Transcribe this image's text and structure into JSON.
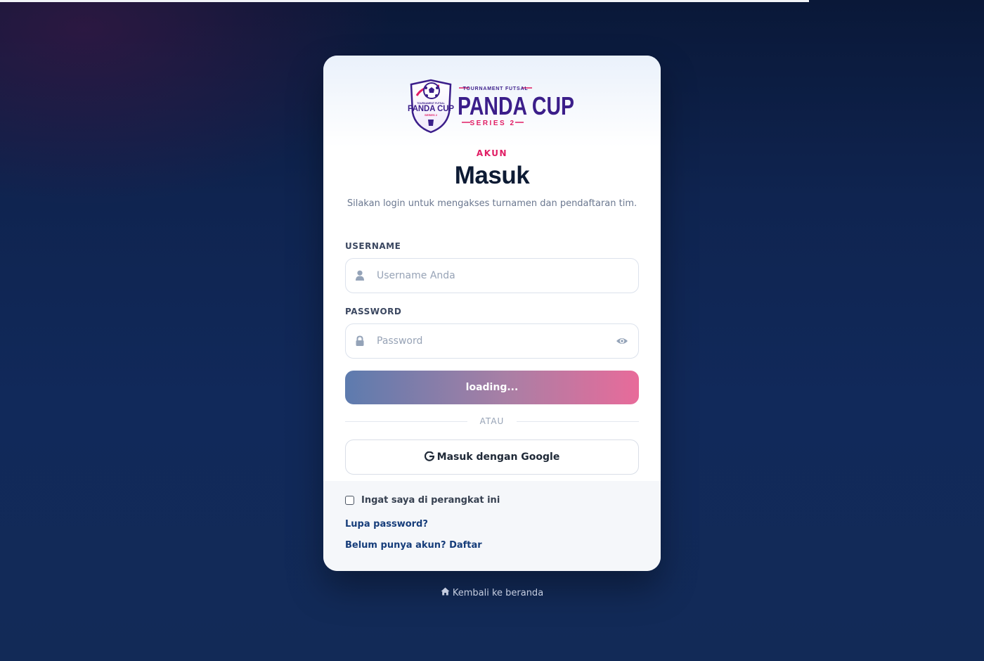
{
  "colors": {
    "accent_pink": "#e11d64",
    "link_blue": "#163d7a",
    "logo_purple": "#3b1e8a",
    "background_navy": "#0f2450"
  },
  "logo": {
    "badge_title": "PANDA CUP",
    "badge_subtitle": "TOURNAMENT FUTSAL",
    "badge_series": "SERIES 2",
    "kicker": "TOURNAMENT FUTSAL",
    "wordmark": "PANDA CUP",
    "series": "SERIES 2"
  },
  "card": {
    "eyebrow": "AKUN",
    "title": "Masuk",
    "subtitle": "Silakan login untuk mengakses turnamen dan pendaftaran tim."
  },
  "form": {
    "username_label": "USERNAME",
    "username_placeholder": "Username Anda",
    "username_value": "",
    "username_icon": "user-icon",
    "password_label": "PASSWORD",
    "password_placeholder": "Password",
    "password_value": "",
    "password_icon": "lock-icon",
    "toggle_icon": "eye-icon",
    "submit_label": "loading...",
    "divider_label": "ATAU",
    "google_icon": "google-icon",
    "google_label": "Masuk dengan Google"
  },
  "footer": {
    "remember_label": "Ingat saya di perangkat ini",
    "remember_checked": false,
    "forgot_link": "Lupa password?",
    "register_link": "Belum punya akun? Daftar"
  },
  "back": {
    "icon": "home-icon",
    "label": "Kembali ke beranda"
  }
}
